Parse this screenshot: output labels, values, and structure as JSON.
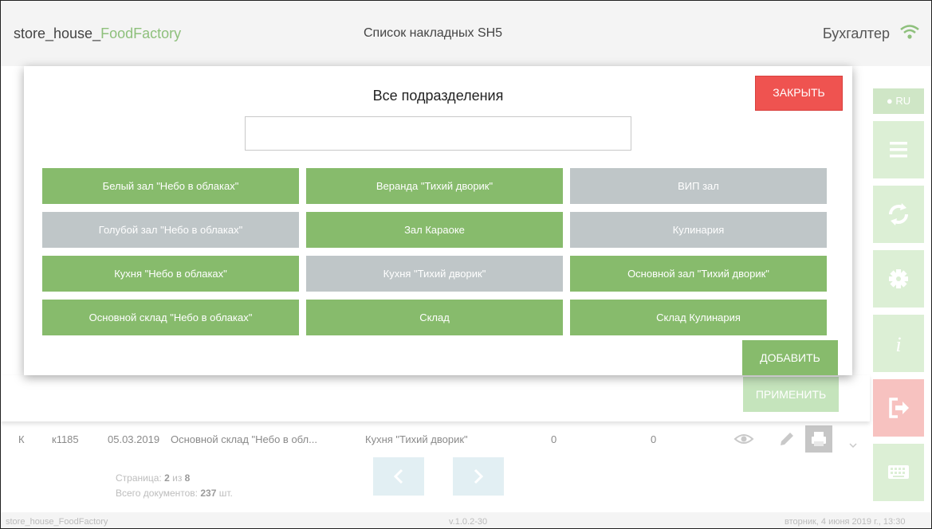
{
  "header": {
    "app_name_prefix": "store_house_",
    "app_name_highlight": "FoodFactory",
    "page_title": "Список накладных SH5",
    "user_role": "Бухгалтер",
    "wifi_icon": "wifi-icon"
  },
  "modal": {
    "title": "Все подразделения",
    "close_label": "ЗАКРЫТЬ",
    "search_value": "",
    "search_placeholder": "",
    "departments": [
      {
        "label": "Белый зал \"Небо в облаках\"",
        "selected": true
      },
      {
        "label": "Веранда \"Тихий дворик\"",
        "selected": true
      },
      {
        "label": "ВИП зал",
        "selected": false
      },
      {
        "label": "Голубой зал \"Небо в облаках\"",
        "selected": false
      },
      {
        "label": "Зал Караоке",
        "selected": true
      },
      {
        "label": "Кулинария",
        "selected": false
      },
      {
        "label": "Кухня \"Небо в облаках\"",
        "selected": true
      },
      {
        "label": "Кухня \"Тихий дворик\"",
        "selected": false
      },
      {
        "label": "Основной зал \"Тихий дворик\"",
        "selected": true
      },
      {
        "label": "Основной склад \"Небо в облаках\"",
        "selected": true
      },
      {
        "label": "Склад",
        "selected": true
      },
      {
        "label": "Склад Кулинария",
        "selected": true
      }
    ],
    "add_label": "ДОБАВИТЬ",
    "apply_label": "ПРИМЕНИТЬ"
  },
  "sidebar": {
    "lang_label": "RU",
    "buttons": [
      "menu-icon",
      "refresh-icon",
      "gear-icon",
      "info-icon",
      "logout-icon",
      "keyboard-icon"
    ]
  },
  "table": {
    "row": {
      "type": "К",
      "number": "к1185",
      "date": "05.03.2019",
      "from": "Основной склад \"Небо в обл...",
      "to": "Кухня \"Тихий дворик\"",
      "sum1": "0",
      "sum2": "0"
    }
  },
  "pagination": {
    "page_label": "Страница:",
    "page": "2",
    "of": "из",
    "total_pages": "8",
    "docs_label": "Всего документов:",
    "docs_count": "237",
    "docs_unit": "шт."
  },
  "footer": {
    "app": "store_house_FoodFactory",
    "version": "v.1.0.2-30",
    "datetime": "вторник, 4 июня 2019 г., 13:30"
  },
  "colors": {
    "accent_green": "#87bb6c",
    "inactive_grey": "#bfc6c8",
    "close_red": "#ef5350"
  }
}
